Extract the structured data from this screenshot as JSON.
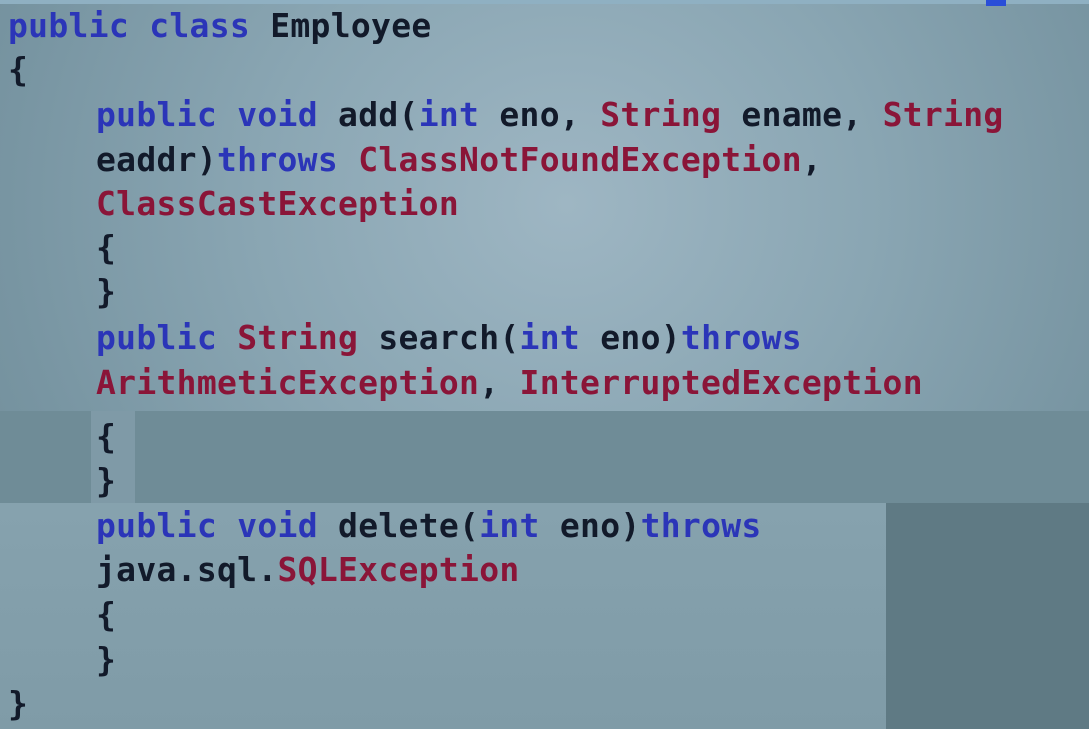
{
  "colors": {
    "keyword": "#2b35b8",
    "type": "#8a1538",
    "text": "#121a2a",
    "background": "#8aa6b3"
  },
  "lines": [
    [
      {
        "t": "public",
        "k": "kw"
      },
      {
        "t": " ",
        "k": "tx"
      },
      {
        "t": "class",
        "k": "kw"
      },
      {
        "t": " Employee",
        "k": "tx"
      }
    ],
    [
      {
        "t": "{",
        "k": "tx"
      }
    ],
    [
      {
        "t": "public",
        "k": "kw"
      },
      {
        "t": " ",
        "k": "tx"
      },
      {
        "t": "void",
        "k": "kw"
      },
      {
        "t": " add(",
        "k": "tx"
      },
      {
        "t": "int",
        "k": "kw"
      },
      {
        "t": " eno, ",
        "k": "tx"
      },
      {
        "t": "String",
        "k": "ty"
      },
      {
        "t": " ename, ",
        "k": "tx"
      },
      {
        "t": "String",
        "k": "ty"
      }
    ],
    [
      {
        "t": "eaddr)",
        "k": "tx"
      },
      {
        "t": "throws",
        "k": "kw"
      },
      {
        "t": " ",
        "k": "tx"
      },
      {
        "t": "ClassNotFoundException",
        "k": "ty"
      },
      {
        "t": ",",
        "k": "tx"
      }
    ],
    [
      {
        "t": "ClassCastException",
        "k": "ty"
      }
    ],
    [
      {
        "t": "{",
        "k": "tx"
      }
    ],
    [
      {
        "t": "}",
        "k": "tx"
      }
    ],
    [
      {
        "t": "public",
        "k": "kw"
      },
      {
        "t": " ",
        "k": "tx"
      },
      {
        "t": "String",
        "k": "ty"
      },
      {
        "t": " search(",
        "k": "tx"
      },
      {
        "t": "int",
        "k": "kw"
      },
      {
        "t": " eno)",
        "k": "tx"
      },
      {
        "t": "throws",
        "k": "kw"
      }
    ],
    [
      {
        "t": "ArithmeticException",
        "k": "ty"
      },
      {
        "t": ", ",
        "k": "tx"
      },
      {
        "t": "InterruptedException",
        "k": "ty"
      }
    ],
    [
      {
        "t": "{",
        "k": "tx"
      }
    ],
    [
      {
        "t": "}",
        "k": "tx"
      }
    ],
    [
      {
        "t": "public",
        "k": "kw"
      },
      {
        "t": " ",
        "k": "tx"
      },
      {
        "t": "void",
        "k": "kw"
      },
      {
        "t": " delete(",
        "k": "tx"
      },
      {
        "t": "int",
        "k": "kw"
      },
      {
        "t": " eno)",
        "k": "tx"
      },
      {
        "t": "throws",
        "k": "kw"
      }
    ],
    [
      {
        "t": "java.sql.",
        "k": "tx"
      },
      {
        "t": "SQLException",
        "k": "ty"
      }
    ],
    [
      {
        "t": "{",
        "k": "tx"
      }
    ],
    [
      {
        "t": "}",
        "k": "tx"
      }
    ],
    [
      {
        "t": "}",
        "k": "tx"
      }
    ]
  ]
}
